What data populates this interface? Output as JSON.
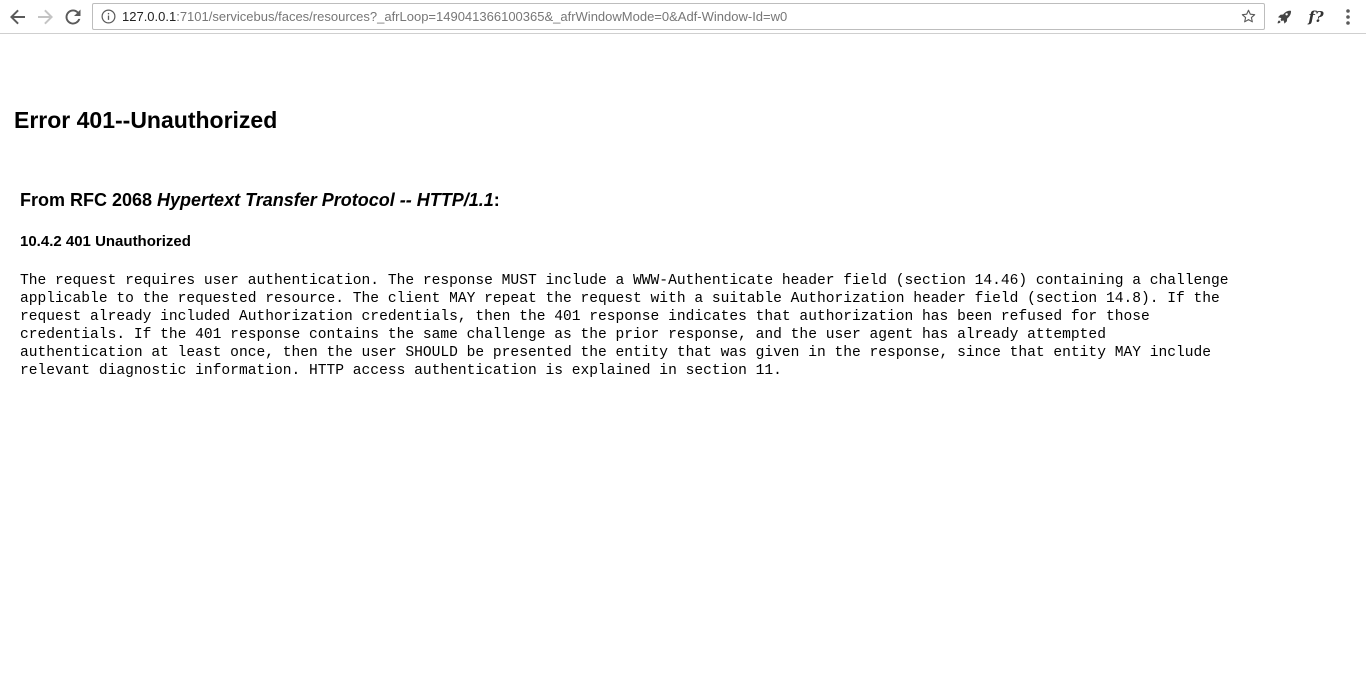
{
  "browser": {
    "url_host": "127.0.0.1",
    "url_rest": ":7101/servicebus/faces/resources?_afrLoop=149041366100365&_afrWindowMode=0&Adf-Window-Id=w0",
    "extension_label": "f?"
  },
  "page": {
    "error_title": "Error 401--Unauthorized",
    "rfc_prefix": "From RFC 2068 ",
    "rfc_title": "Hypertext Transfer Protocol -- HTTP/1.1",
    "rfc_suffix": ":",
    "section_heading": "10.4.2 401 Unauthorized",
    "body_lines": [
      "The request requires user authentication. The response MUST include a WWW-Authenticate header field (section 14.46) containing a challenge",
      "applicable to the requested resource. The client MAY repeat the request with a suitable Authorization header field (section 14.8). If the",
      "request already included Authorization credentials, then the 401 response indicates that authorization has been refused for those",
      "credentials. If the 401 response contains the same challenge as the prior response, and the user agent has already attempted",
      "authentication at least once, then the user SHOULD be presented the entity that was given in the response, since that entity MAY include",
      "relevant diagnostic information. HTTP access authentication is explained in section 11."
    ]
  }
}
